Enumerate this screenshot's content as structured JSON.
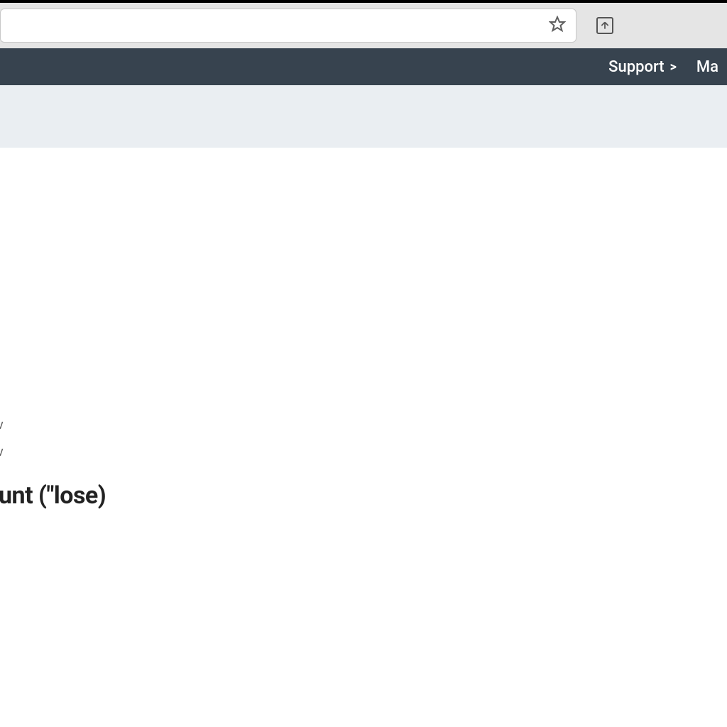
{
  "browser": {
    "url_value": ""
  },
  "nav": {
    "support_label": "Support",
    "chevron": ">",
    "partial_right": "Ma"
  },
  "content": {
    "partial_line_1": "v",
    "partial_line_2": "v",
    "heading_partial": "unt (\"lose)"
  }
}
